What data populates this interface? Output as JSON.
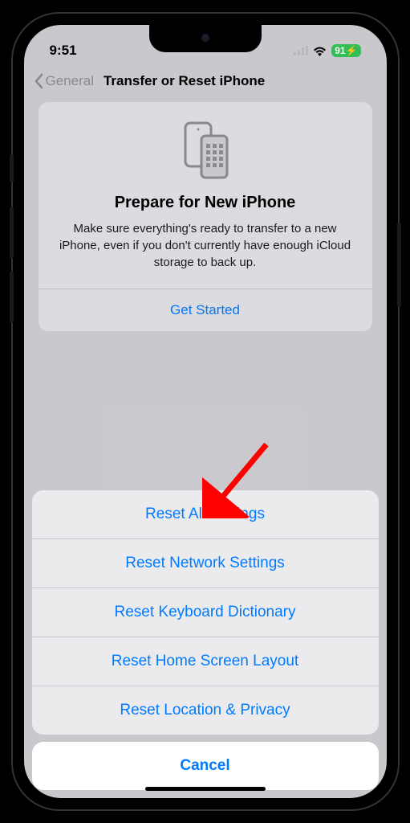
{
  "status": {
    "time": "9:51",
    "battery": "91"
  },
  "nav": {
    "back_label": "General",
    "title": "Transfer or Reset iPhone"
  },
  "card": {
    "title": "Prepare for New iPhone",
    "description": "Make sure everything's ready to transfer to a new iPhone, even if you don't currently have enough iCloud storage to back up.",
    "action": "Get Started"
  },
  "sheet": {
    "items": [
      "Reset All Settings",
      "Reset Network Settings",
      "Reset Keyboard Dictionary",
      "Reset Home Screen Layout",
      "Reset Location & Privacy"
    ],
    "cancel": "Cancel"
  }
}
